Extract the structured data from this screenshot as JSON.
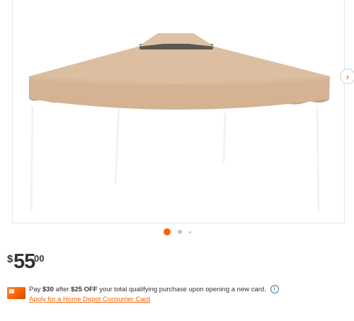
{
  "gallery": {
    "image_alt": "gazebo replacement canopy top",
    "next_icon": "chevron-right-icon",
    "dots": [
      {
        "state": "active"
      },
      {
        "state": "inactive"
      },
      {
        "state": "inactive-small"
      }
    ]
  },
  "price": {
    "currency": "$",
    "dollars": "55",
    "cents": "00"
  },
  "promo": {
    "icon": "credit-card-icon",
    "text_pay": "Pay",
    "amount_after": "$30",
    "text_after": "after",
    "amount_off": "$25 OFF",
    "text_rest": "your total qualifying purchase upon opening a new card.",
    "info_icon": "info-icon",
    "info_glyph": "i",
    "link_label": "Apply for a Home Depot Consumer Card"
  },
  "colors": {
    "accent": "#f96302",
    "canopy": "#d9b99b",
    "canopy_shadow": "#c49f80",
    "info_blue": "#3e7697"
  }
}
